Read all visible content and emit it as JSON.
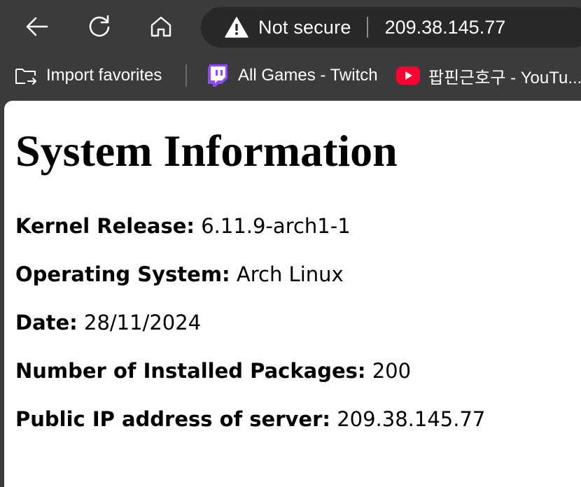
{
  "browser": {
    "security_label": "Not secure",
    "url": "209.38.145.77",
    "favorites": [
      {
        "label": "Import favorites",
        "icon": "import-favorites-icon"
      },
      {
        "label": "All Games - Twitch",
        "icon": "twitch-icon"
      },
      {
        "label": "팝핀근호구 - YouTu...",
        "icon": "youtube-icon"
      }
    ]
  },
  "page": {
    "title": "System Information",
    "fields": [
      {
        "label": "Kernel Release:",
        "value": "6.11.9-arch1-1"
      },
      {
        "label": "Operating System:",
        "value": "Arch Linux"
      },
      {
        "label": "Date:",
        "value": "28/11/2024"
      },
      {
        "label": "Number of Installed Packages:",
        "value": "200"
      },
      {
        "label": "Public IP address of server:",
        "value": "209.38.145.77"
      }
    ]
  },
  "colors": {
    "chrome_bg": "#3b3b3b",
    "address_bar_bg": "#282828",
    "twitch_purple": "#9146ff",
    "youtube_red": "#ff0033"
  }
}
